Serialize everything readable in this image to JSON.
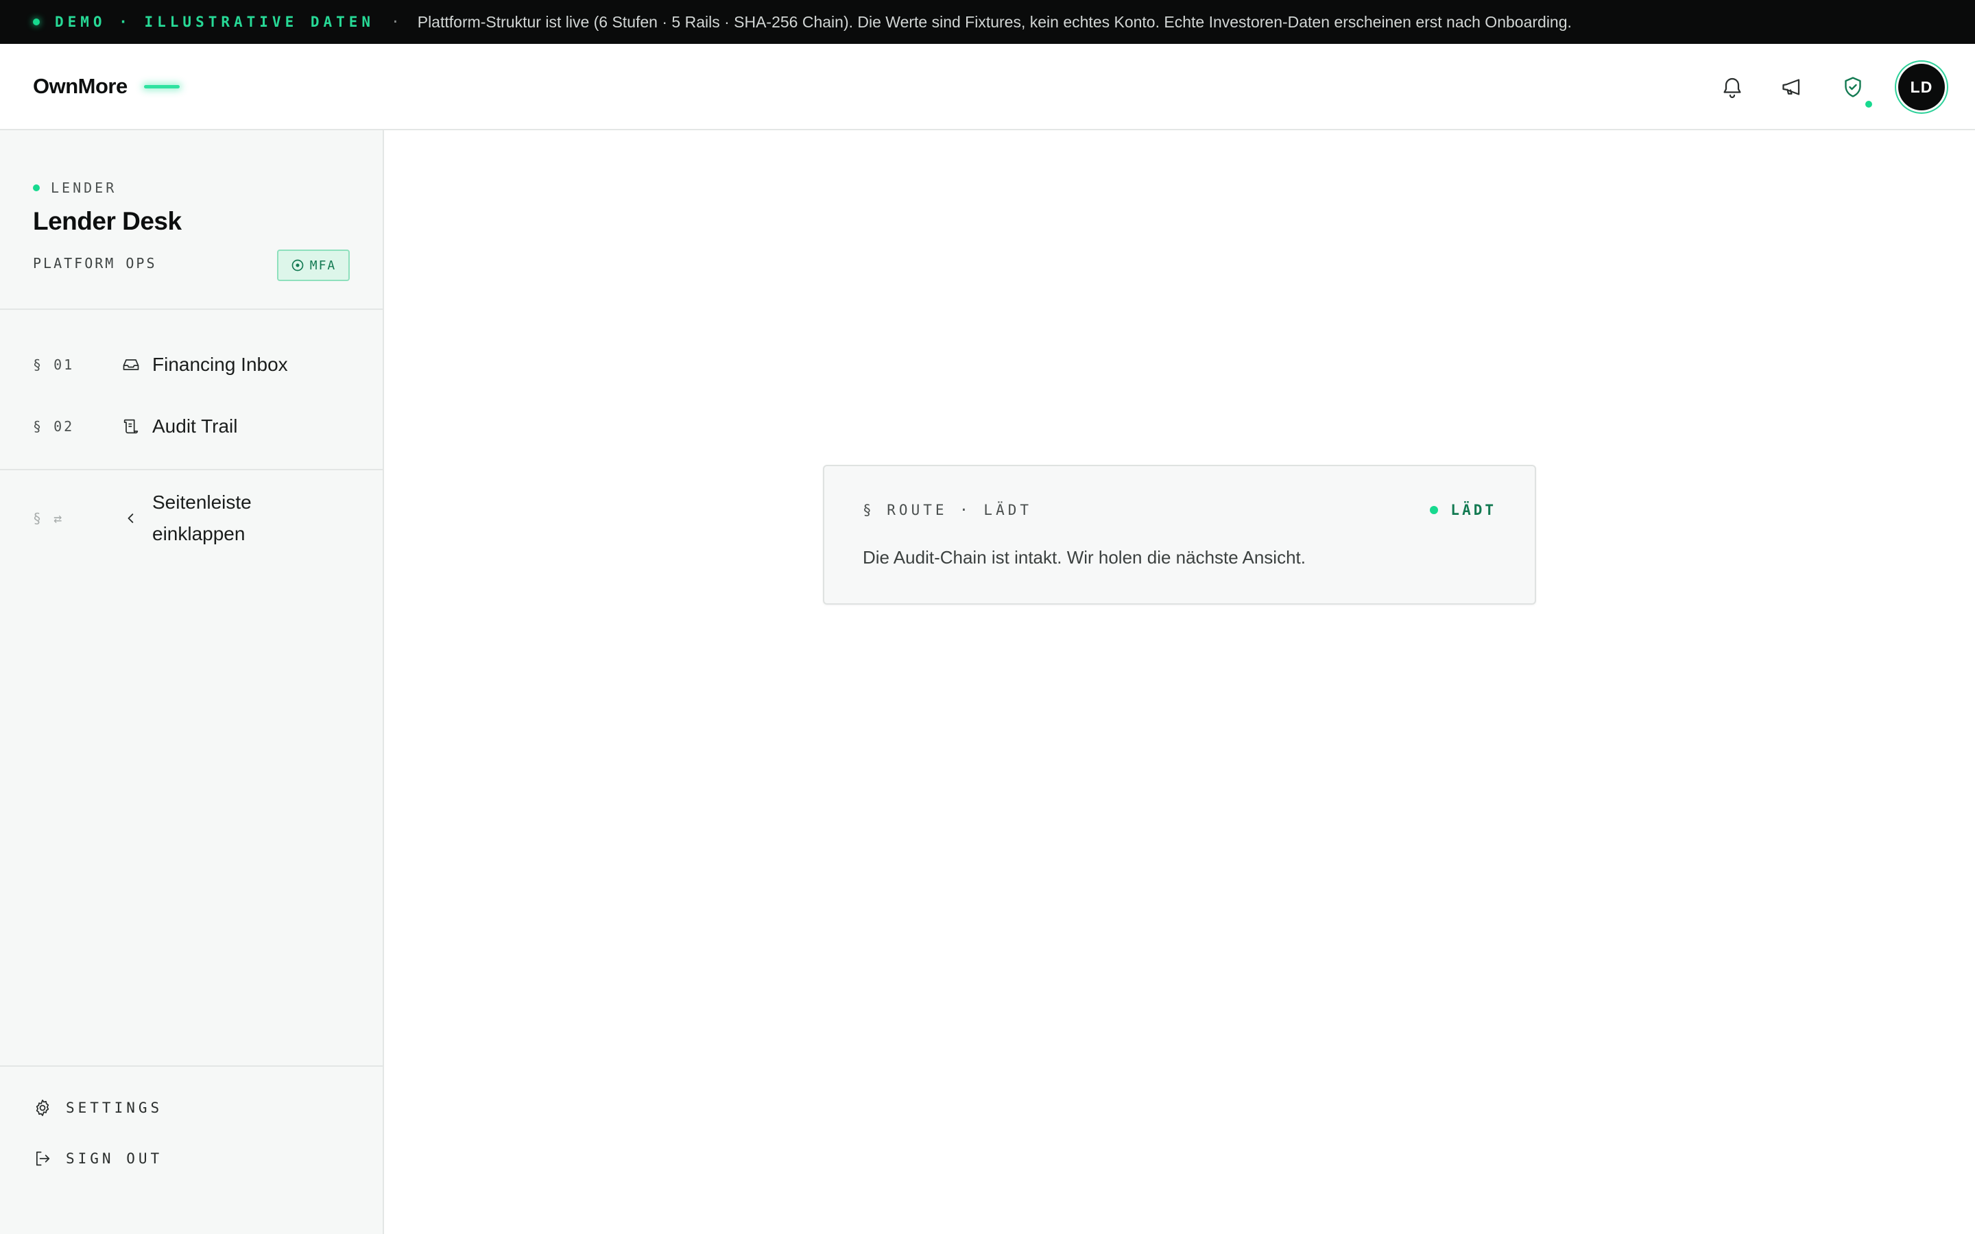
{
  "banner": {
    "tag": "DEMO · ILLUSTRATIVE DATEN",
    "separator": "·",
    "message": "Plattform-Struktur ist live (6 Stufen · 5 Rails · SHA-256 Chain). Die Werte sind Fixtures, kein echtes Konto. Echte Investoren-Daten erscheinen erst nach Onboarding."
  },
  "header": {
    "logo": "OwnMore",
    "avatar_initials": "LD",
    "icons": [
      "bell-icon",
      "megaphone-icon",
      "shield-check-icon"
    ]
  },
  "sidebar": {
    "role": "LENDER",
    "title": "Lender Desk",
    "subtitle": "PLATFORM OPS",
    "mfa_label": "MFA",
    "nav": [
      {
        "num": "§ 01",
        "label": "Financing Inbox",
        "icon": "inbox-icon"
      },
      {
        "num": "§ 02",
        "label": "Audit Trail",
        "icon": "scroll-icon"
      }
    ],
    "collapse": {
      "num": "§ ⇄",
      "label": "Seitenleiste einklappen",
      "icon": "chevron-left-icon"
    },
    "footer": {
      "settings": "SETTINGS",
      "sign_out": "SIGN OUT"
    }
  },
  "main": {
    "card": {
      "eyebrow": "§ ROUTE · LÄDT",
      "status": "LÄDT",
      "description": "Die Audit-Chain ist intakt. Wir holen die nächste Ansicht."
    }
  },
  "colors": {
    "accent": "#17d98f",
    "accent_dark": "#137a52",
    "banner_bg": "#0a0b0b",
    "sidebar_bg": "#f6f8f7"
  }
}
